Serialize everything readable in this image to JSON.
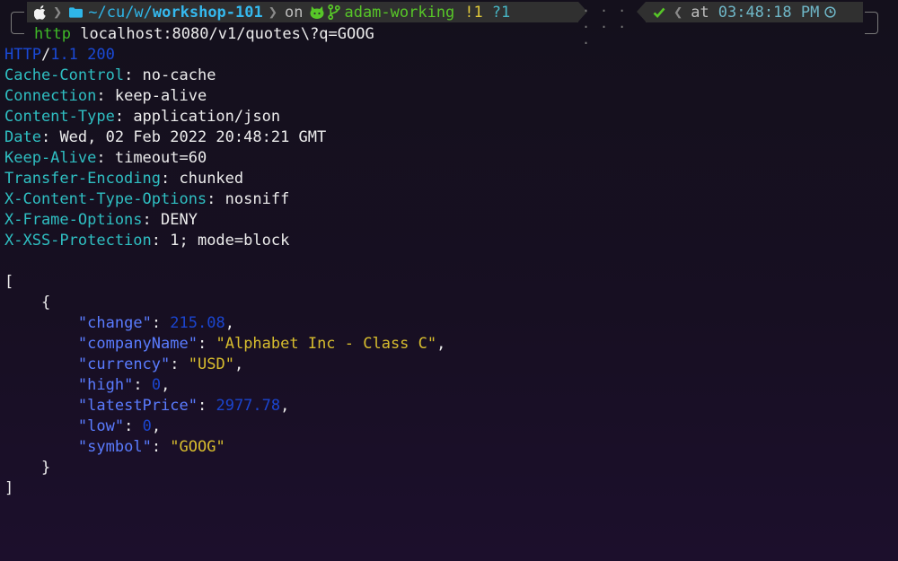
{
  "prompt": {
    "path": "~/cu/w/",
    "dir": "workshop-101",
    "on_label": "on",
    "branch": "adam-working",
    "git_modified": "!1",
    "git_untracked": "?1",
    "dots": "· · · · · · ·",
    "at_label": "at",
    "time": "03:48:18 PM"
  },
  "command": {
    "program": "http",
    "args": "localhost:8080/v1/quotes\\?q=GOOG"
  },
  "response": {
    "protocol": "HTTP",
    "version": "1.1",
    "status": "200",
    "headers": [
      {
        "key": "Cache-Control",
        "value": "no-cache"
      },
      {
        "key": "Connection",
        "value": "keep-alive"
      },
      {
        "key": "Content-Type",
        "value": "application/json"
      },
      {
        "key": "Date",
        "value": "Wed, 02 Feb 2022 20:48:21 GMT"
      },
      {
        "key": "Keep-Alive",
        "value": "timeout=60"
      },
      {
        "key": "Transfer-Encoding",
        "value": "chunked"
      },
      {
        "key": "X-Content-Type-Options",
        "value": "nosniff"
      },
      {
        "key": "X-Frame-Options",
        "value": "DENY"
      },
      {
        "key": "X-XSS-Protection",
        "value": "1; mode=block"
      }
    ],
    "body": [
      {
        "key": "change",
        "value": "215.08",
        "type": "number"
      },
      {
        "key": "companyName",
        "value": "Alphabet Inc - Class C",
        "type": "string"
      },
      {
        "key": "currency",
        "value": "USD",
        "type": "string"
      },
      {
        "key": "high",
        "value": "0",
        "type": "number"
      },
      {
        "key": "latestPrice",
        "value": "2977.78",
        "type": "number"
      },
      {
        "key": "low",
        "value": "0",
        "type": "number"
      },
      {
        "key": "symbol",
        "value": "GOOG",
        "type": "string"
      }
    ]
  }
}
